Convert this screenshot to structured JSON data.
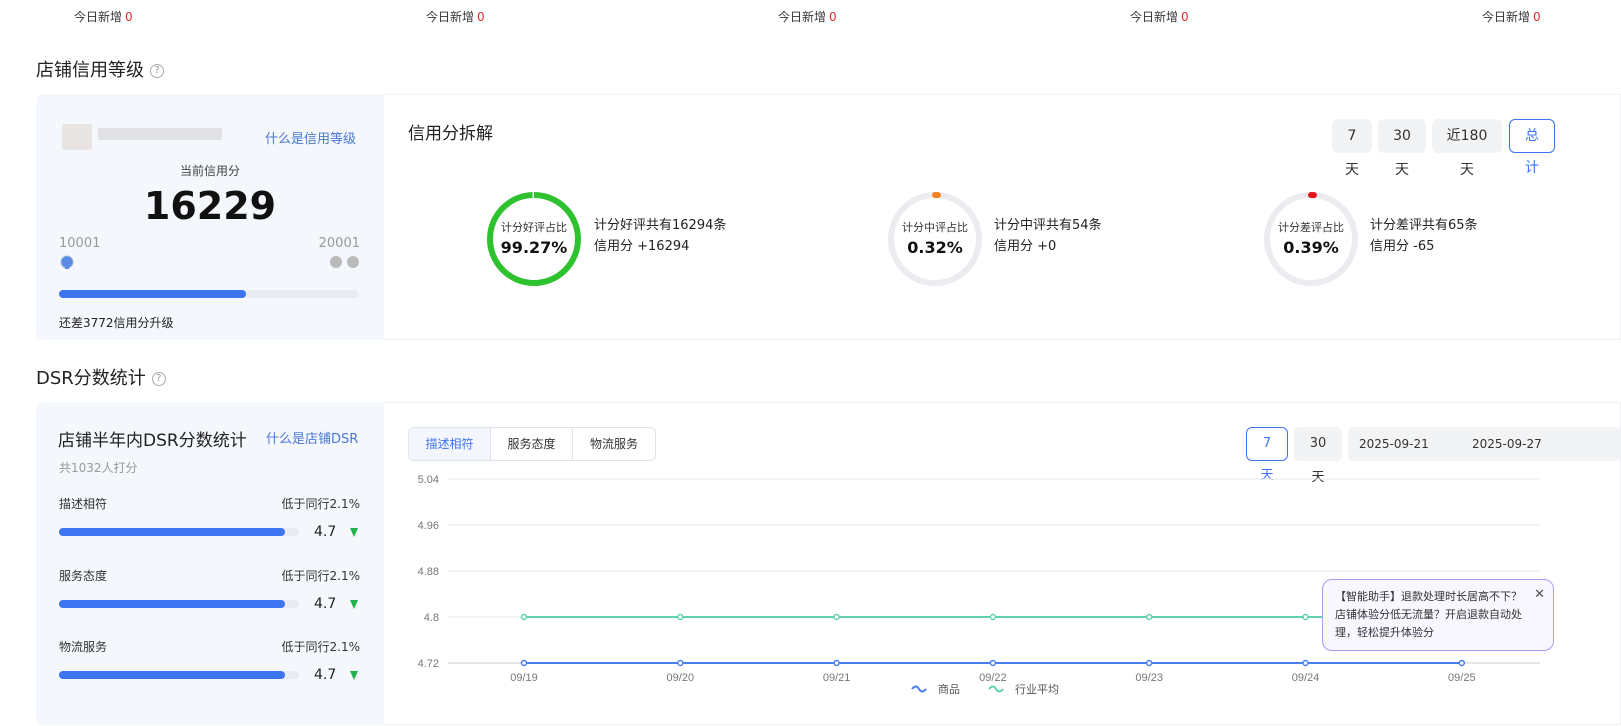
{
  "top_stats": [
    {
      "label": "今日新增",
      "value": "0"
    },
    {
      "label": "今日新增",
      "value": "0"
    },
    {
      "label": "今日新增",
      "value": "0"
    },
    {
      "label": "今日新增",
      "value": "0"
    },
    {
      "label": "今日新增",
      "value": "0"
    }
  ],
  "credit": {
    "section_title": "店铺信用等级",
    "help_glyph": "?",
    "what_link": "什么是信用等级",
    "current_label": "当前信用分",
    "score": "16229",
    "min_value": "10001",
    "max_value": "20001",
    "progress": 0.6229,
    "remaining_text": "还差3772信用分升级"
  },
  "breakdown": {
    "title": "信用分拆解",
    "periods": [
      "7天",
      "30天",
      "近180天",
      "总计"
    ],
    "active_period": "总计",
    "items": [
      {
        "label": "计分好评占比",
        "percent": "99.27%",
        "ratio": 0.9927,
        "color": "#2ec22e",
        "desc1": "计分好评共有16294条",
        "desc2": "信用分 +16294"
      },
      {
        "label": "计分中评占比",
        "percent": "0.32%",
        "ratio": 0.0032,
        "color": "#f5821f",
        "desc1": "计分中评共有54条",
        "desc2": "信用分 +0"
      },
      {
        "label": "计分差评占比",
        "percent": "0.39%",
        "ratio": 0.0039,
        "color": "#e8141b",
        "desc1": "计分差评共有65条",
        "desc2": "信用分 -65"
      }
    ]
  },
  "dsr": {
    "section_title": "DSR分数统计",
    "help_glyph": "?",
    "panel_title": "店铺半年内DSR分数统计",
    "what_link": "什么是店铺DSR",
    "count_text": "共1032人打分",
    "rows": [
      {
        "label": "描述相符",
        "compare": "低于同行2.1%",
        "score": "4.7",
        "ratio": 0.94
      },
      {
        "label": "服务态度",
        "compare": "低于同行2.1%",
        "score": "4.7",
        "ratio": 0.94
      },
      {
        "label": "物流服务",
        "compare": "低于同行2.1%",
        "score": "4.7",
        "ratio": 0.94
      }
    ],
    "tabs": [
      "描述相符",
      "服务态度",
      "物流服务"
    ],
    "active_tab": "描述相符",
    "range_buttons": [
      "7天",
      "30天"
    ],
    "active_range": "7天",
    "date_start": "2025-09-21",
    "date_end": "2025-09-27",
    "tip_text": "【智能助手】退款处理时长居高不下？店铺体验分低无流量？开启退款自动处理，轻松提升体验分",
    "close_glyph": "✕"
  },
  "chart_data": {
    "type": "line",
    "x": [
      "09/19",
      "09/20",
      "09/21",
      "09/22",
      "09/23",
      "09/24",
      "09/25"
    ],
    "y_ticks": [
      "5.04",
      "4.96",
      "4.88",
      "4.8",
      "4.72"
    ],
    "ylim": [
      4.72,
      5.04
    ],
    "grid": true,
    "legend_position": "bottom",
    "series": [
      {
        "name": "商品",
        "color": "#4a7ff0",
        "values": [
          4.72,
          4.72,
          4.72,
          4.72,
          4.72,
          4.72,
          4.72
        ]
      },
      {
        "name": "行业平均",
        "color": "#5fd3a8",
        "values": [
          4.8,
          4.8,
          4.8,
          4.8,
          4.8,
          4.8,
          4.8
        ]
      }
    ]
  }
}
